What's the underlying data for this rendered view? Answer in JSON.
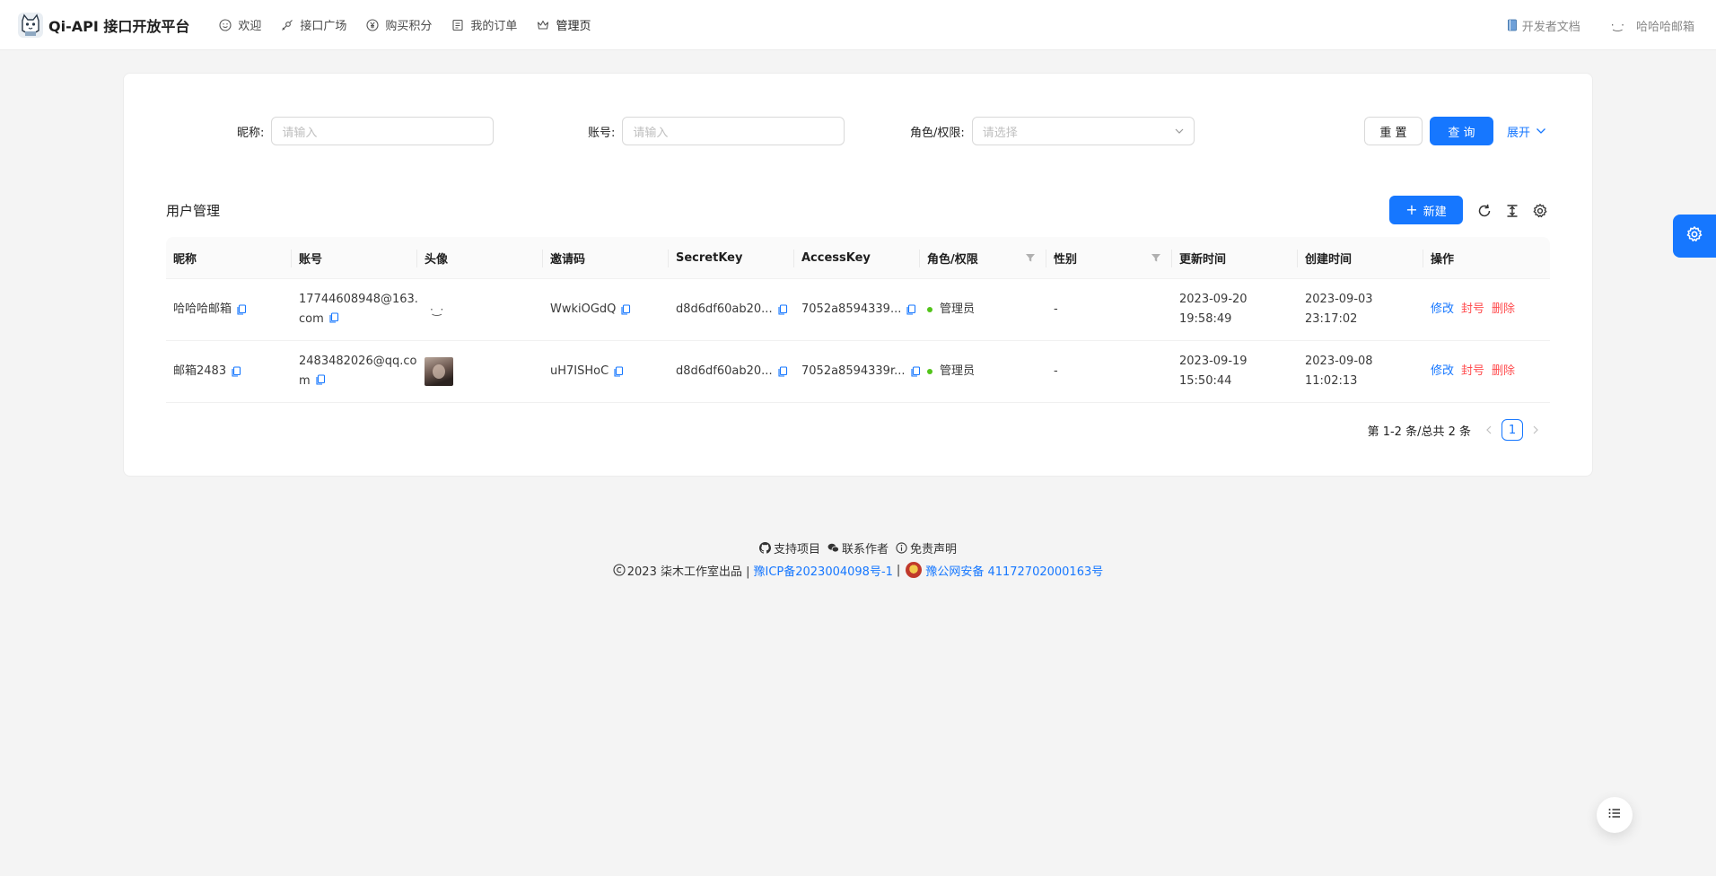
{
  "app": {
    "title": "Qi-API 接口开放平台"
  },
  "nav": {
    "items": [
      {
        "label": "欢迎",
        "icon": "smile-icon"
      },
      {
        "label": "接口广场",
        "icon": "api-icon"
      },
      {
        "label": "购买积分",
        "icon": "yuan-icon"
      },
      {
        "label": "我的订单",
        "icon": "order-icon"
      },
      {
        "label": "管理页",
        "icon": "crown-icon"
      }
    ]
  },
  "header_right": {
    "docs_label": "开发者文档",
    "avatar_face": "·‿·",
    "user_name": "哈哈哈邮箱"
  },
  "search": {
    "nickname_label": "昵称:",
    "nickname_placeholder": "请输入",
    "account_label": "账号:",
    "account_placeholder": "请输入",
    "role_label": "角色/权限:",
    "role_placeholder": "请选择",
    "reset_label": "重 置",
    "query_label": "查 询",
    "expand_label": "展开"
  },
  "table": {
    "title": "用户管理",
    "new_label": "新建",
    "columns": [
      "昵称",
      "账号",
      "头像",
      "邀请码",
      "SecretKey",
      "AccessKey",
      "角色/权限",
      "性别",
      "更新时间",
      "创建时间",
      "操作"
    ],
    "rows": [
      {
        "nickname": "哈哈哈邮箱",
        "account_line1": "17744608948@163.",
        "account_line2": "com",
        "avatar_face": "·‿·",
        "invite": "WwkiOGdQ",
        "secret": "d8d6df60ab20...",
        "access": "7052a8594339...",
        "role": "管理员",
        "gender": "-",
        "updated_date": "2023-09-20",
        "updated_time": "19:58:49",
        "created_date": "2023-09-03",
        "created_time": "23:17:02",
        "actions": [
          "修改",
          "封号",
          "删除"
        ]
      },
      {
        "nickname": "邮箱2483",
        "account_line1": "2483482026@qq.co",
        "account_line2": "m",
        "avatar_face": "",
        "invite": "uH7ISHoC",
        "secret": "d8d6df60ab20...",
        "access": "7052a8594339r...",
        "role": "管理员",
        "gender": "-",
        "updated_date": "2023-09-19",
        "updated_time": "15:50:44",
        "created_date": "2023-09-08",
        "created_time": "11:02:13",
        "actions": [
          "修改",
          "封号",
          "删除"
        ]
      }
    ]
  },
  "pagination": {
    "summary": "第 1-2 条/总共 2 条",
    "current": "1"
  },
  "footer": {
    "links": [
      "支持项目",
      "联系作者",
      "免责声明"
    ],
    "copyright": "2023 柒木工作室出品 |",
    "icp": "豫ICP备2023004098号-1",
    "sep": "|",
    "police": "豫公网安备 41172702000163号"
  },
  "colors": {
    "primary": "#1677ff",
    "danger": "#ff4d4f",
    "success": "#52c41a"
  }
}
